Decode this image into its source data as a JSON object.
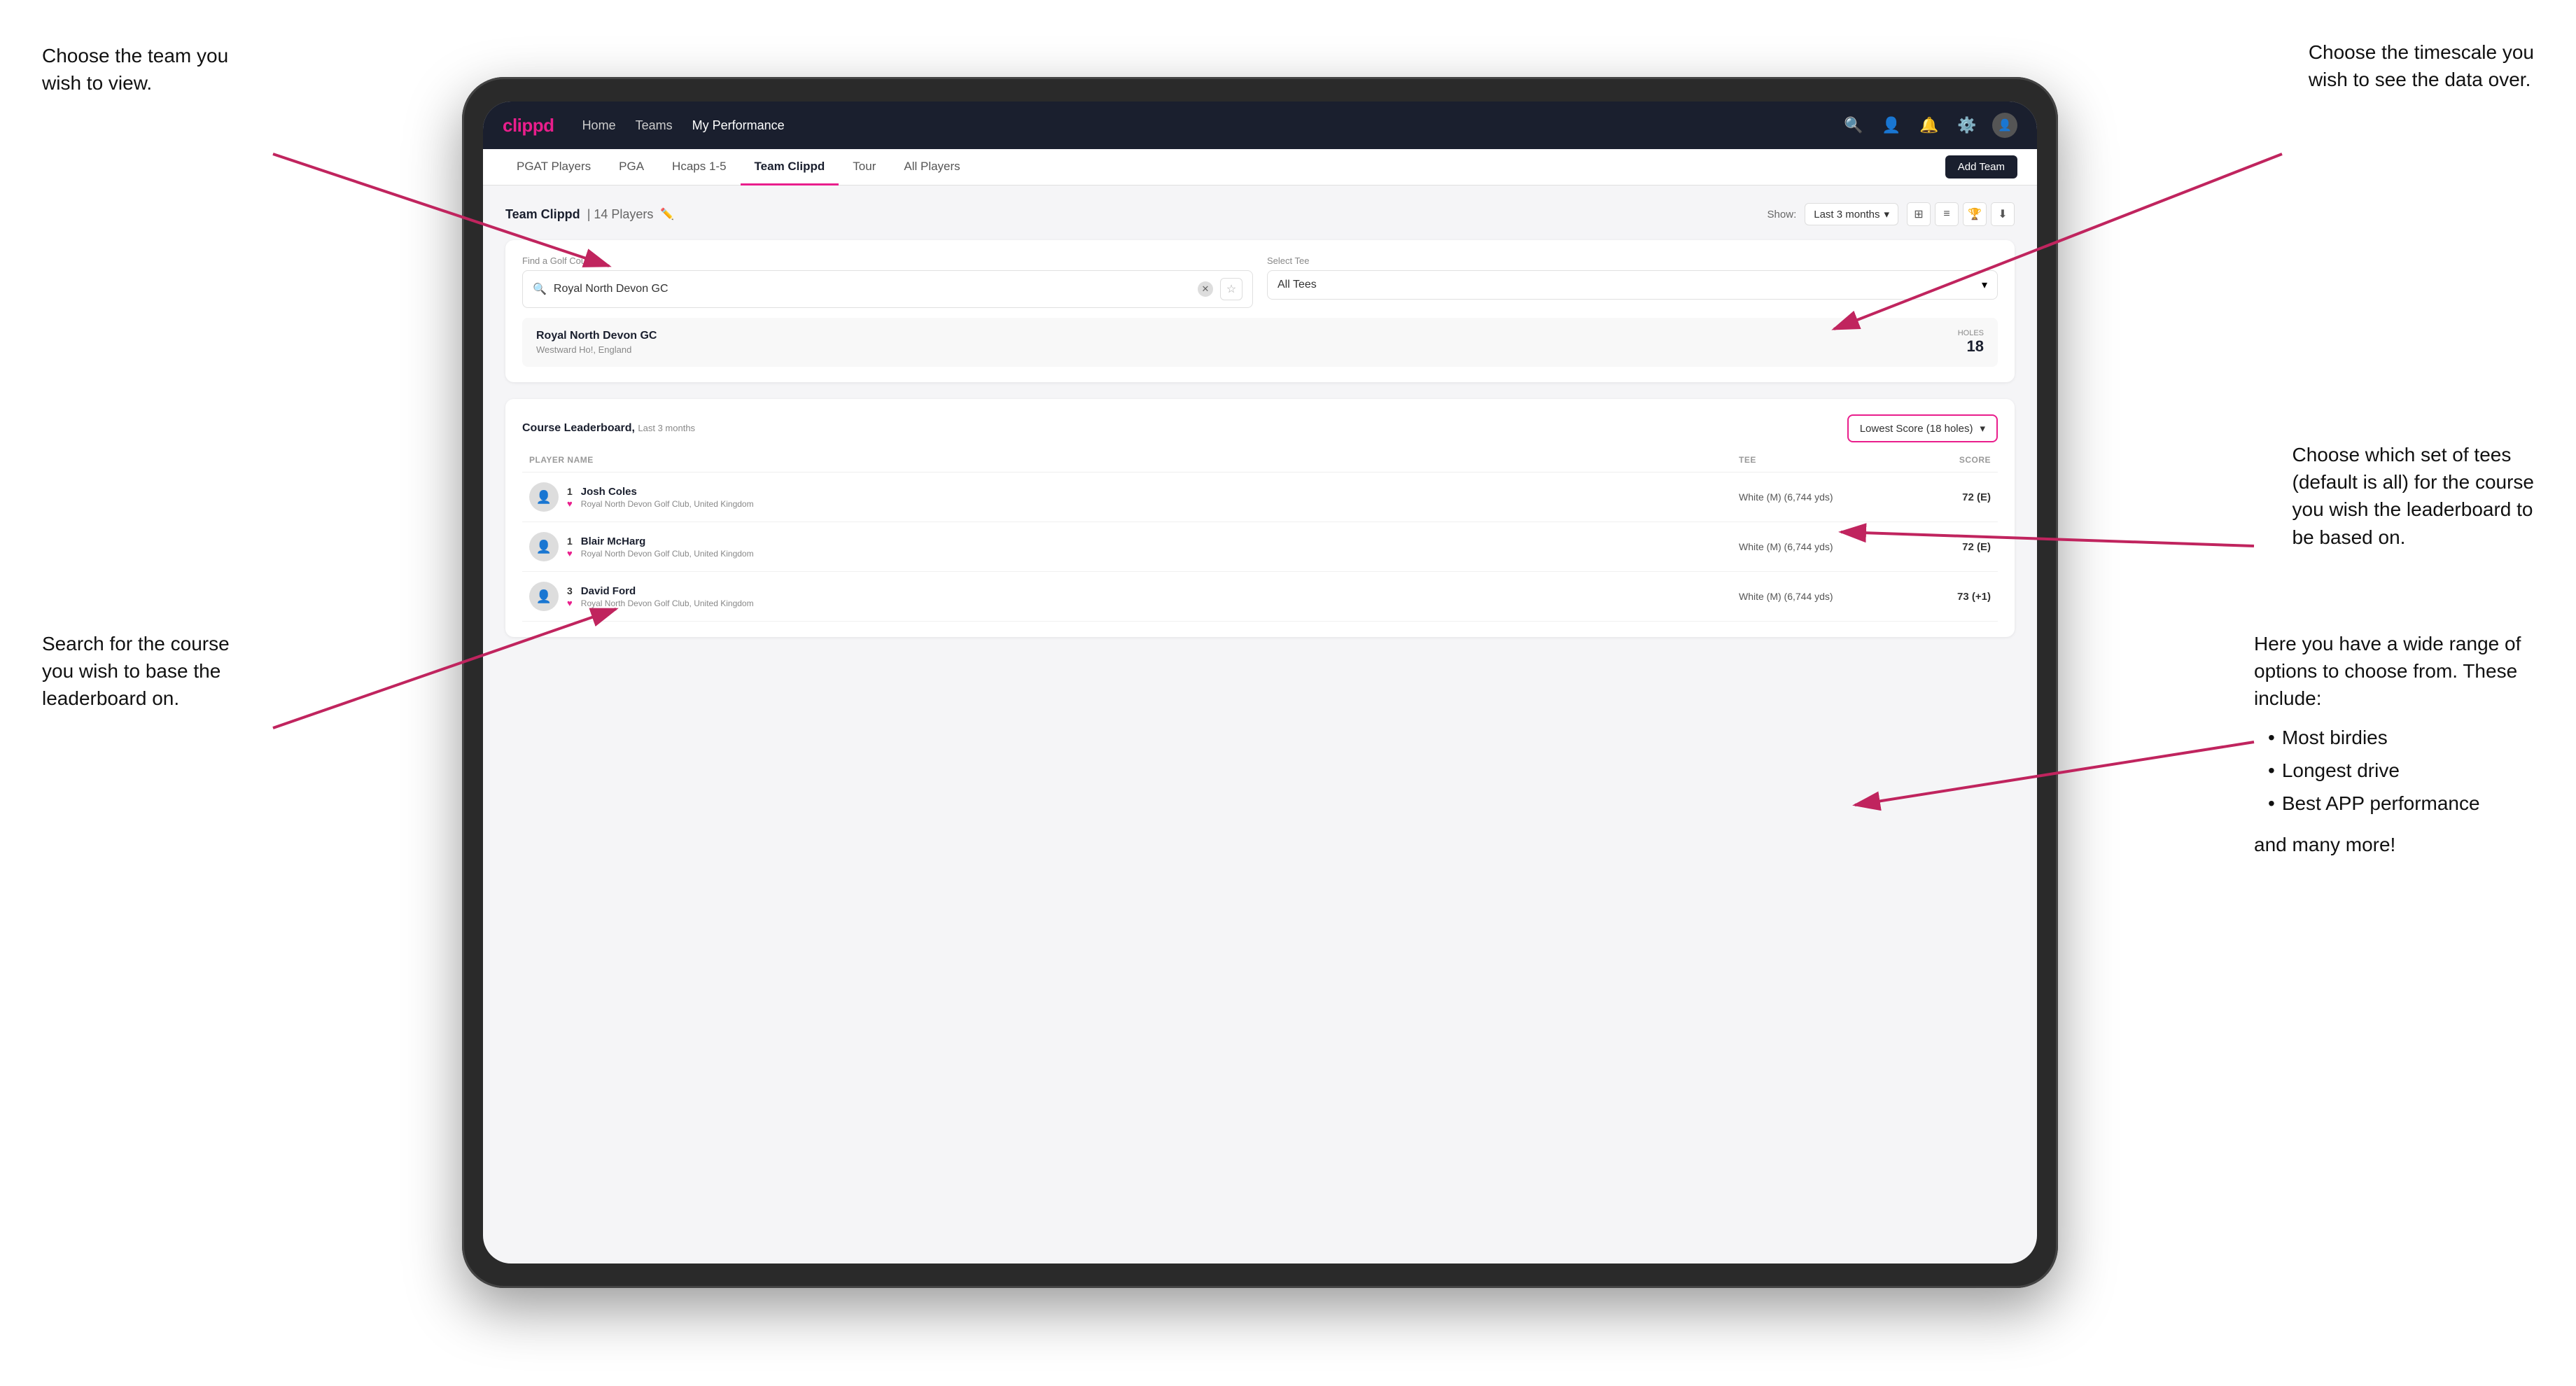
{
  "annotations": {
    "top_left": {
      "line1": "Choose the team you",
      "line2": "wish to view."
    },
    "bottom_left": {
      "line1": "Search for the course",
      "line2": "you wish to base the",
      "line3": "leaderboard on."
    },
    "top_right": {
      "line1": "Choose the timescale you",
      "line2": "wish to see the data over."
    },
    "mid_right": {
      "line1": "Choose which set of tees",
      "line2": "(default is all) for the course",
      "line3": "you wish the leaderboard to",
      "line4": "be based on."
    },
    "bottom_right": {
      "intro": "Here you have a wide range of options to choose from. These include:",
      "bullets": [
        "Most birdies",
        "Longest drive",
        "Best APP performance"
      ],
      "outro": "and many more!"
    }
  },
  "navbar": {
    "logo": "clippd",
    "nav_items": [
      "Home",
      "Teams",
      "My Performance"
    ],
    "active_nav": "My Performance"
  },
  "sub_nav": {
    "tabs": [
      "PGAT Players",
      "PGA",
      "Hcaps 1-5",
      "Team Clippd",
      "Tour",
      "All Players"
    ],
    "active_tab": "Team Clippd",
    "add_team_label": "Add Team"
  },
  "team_header": {
    "title": "Team Clippd",
    "player_count": "14 Players",
    "show_label": "Show:",
    "show_value": "Last 3 months"
  },
  "course_search": {
    "find_label": "Find a Golf Course",
    "search_value": "Royal North Devon GC",
    "select_tee_label": "Select Tee",
    "tee_value": "All Tees"
  },
  "course_result": {
    "name": "Royal North Devon GC",
    "location": "Westward Ho!, England",
    "holes_label": "Holes",
    "holes_value": "18"
  },
  "leaderboard": {
    "title": "Course Leaderboard,",
    "subtitle": "Last 3 months",
    "score_dropdown_value": "Lowest Score (18 holes)",
    "columns": [
      "PLAYER NAME",
      "",
      "TEE",
      "SCORE"
    ],
    "rows": [
      {
        "rank": "1",
        "name": "Josh Coles",
        "club": "Royal North Devon Golf Club, United Kingdom",
        "tee": "White (M) (6,744 yds)",
        "score": "72 (E)"
      },
      {
        "rank": "1",
        "name": "Blair McHarg",
        "club": "Royal North Devon Golf Club, United Kingdom",
        "tee": "White (M) (6,744 yds)",
        "score": "72 (E)"
      },
      {
        "rank": "3",
        "name": "David Ford",
        "club": "Royal North Devon Golf Club, United Kingdom",
        "tee": "White (M) (6,744 yds)",
        "score": "73 (+1)"
      }
    ]
  }
}
